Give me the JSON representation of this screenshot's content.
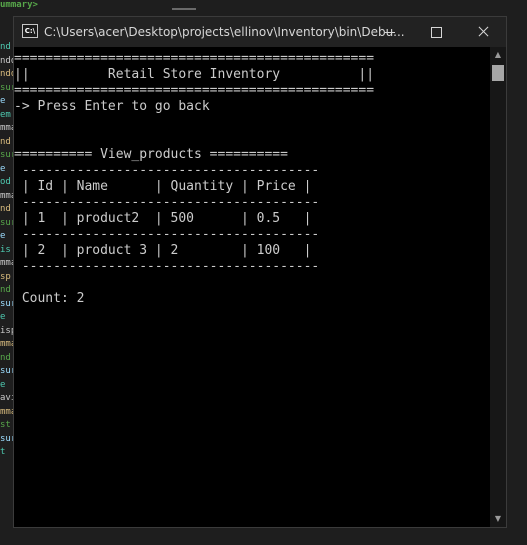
{
  "background_editor": {
    "top_text": "ummary>",
    "margin_fragments": [
      "nd",
      "ndd",
      "ndd",
      "sur",
      "e",
      "em",
      "mma",
      "nd",
      "sur",
      "e",
      "od",
      "mma",
      "nd",
      "sur",
      "e",
      "is",
      "mma",
      "sp",
      "nd",
      "sur",
      "e",
      "isp",
      "mma",
      "nd",
      "sur",
      "e",
      "avi",
      "mma",
      "st",
      "sur",
      "t"
    ]
  },
  "window": {
    "title": "C:\\Users\\acer\\Desktop\\projects\\ellinov\\Inventory\\bin\\Debu...",
    "icon_label": "C:\\",
    "minimize_label": "Minimize",
    "maximize_label": "Maximize",
    "close_label": "Close"
  },
  "console": {
    "lines": [
      "==============================================",
      "||          Retail Store Inventory          ||",
      "==============================================",
      "-> Press Enter to go back",
      "",
      "",
      "========== View_products ==========",
      " --------------------------------------",
      " | Id | Name      | Quantity | Price |",
      " --------------------------------------",
      " | 1  | product2  | 500      | 0.5   |",
      " --------------------------------------",
      " | 2  | product 3 | 2        | 100   |",
      " --------------------------------------",
      "",
      "",
      " Count: 2"
    ],
    "products_table": {
      "columns": [
        "Id",
        "Name",
        "Quantity",
        "Price"
      ],
      "rows": [
        [
          "1",
          "product2",
          "500",
          "0.5"
        ],
        [
          "2",
          "product 3",
          "2",
          "100"
        ]
      ],
      "count_label": "Count: 2"
    }
  },
  "colors": {
    "console_bg": "#000000",
    "console_text": "#cccccc",
    "titlebar_bg": "#222222",
    "editor_bg": "#1e1e1e",
    "editor_green": "#57a64a"
  }
}
